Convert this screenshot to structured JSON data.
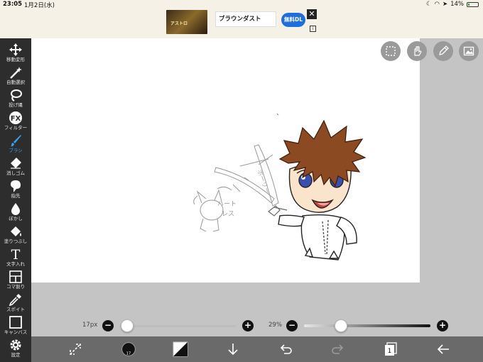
{
  "status_bar": {
    "time": "23:05",
    "date": "1月2日(水)",
    "battery_text": "14%",
    "battery_level": 0.14
  },
  "ad": {
    "thumb_text": "アストロ",
    "title": "ブラウンダスト",
    "cta": "無料DL",
    "close_glyph": "✕",
    "info_glyph": "i"
  },
  "toolbar": {
    "tools": [
      {
        "label": "移動変形",
        "icon": "move-icon"
      },
      {
        "label": "自動選択",
        "icon": "magic-wand-icon"
      },
      {
        "label": "投げ縄",
        "icon": "lasso-icon"
      },
      {
        "label": "フィルター",
        "icon": "fx-icon",
        "glyph": "FX"
      },
      {
        "label": "ブラシ",
        "icon": "brush-icon",
        "active": true
      },
      {
        "label": "消しゴム",
        "icon": "eraser-icon"
      },
      {
        "label": "指先",
        "icon": "finger-icon"
      },
      {
        "label": "ぼかし",
        "icon": "blur-drop-icon"
      },
      {
        "label": "塗りつぶし",
        "icon": "bucket-icon"
      },
      {
        "label": "文字入れ",
        "icon": "text-icon",
        "glyph": "T"
      },
      {
        "label": "コマ割り",
        "icon": "frame-icon"
      },
      {
        "label": "スポイト",
        "icon": "eyedropper-icon"
      },
      {
        "label": "キャンバス",
        "icon": "canvas-icon"
      },
      {
        "label": "設定",
        "icon": "gear-icon"
      }
    ]
  },
  "top_buttons": [
    "selection-icon",
    "hand-icon",
    "pen-icon",
    "image-icon"
  ],
  "brush_size": {
    "label": "17px",
    "value_fraction": 0.0,
    "minus": "−",
    "plus": "+"
  },
  "opacity": {
    "label": "29%",
    "value_fraction": 0.29,
    "minus": "−",
    "plus": "+"
  },
  "bottom_bar": {
    "brush_size_badge": "17",
    "layer_count": "1",
    "items": [
      "transform-arrows-icon",
      "brush-size-icon",
      "color-swatch-icon",
      "download-icon",
      "undo-icon",
      "redo-icon",
      "layers-icon",
      "back-arrow-icon"
    ]
  },
  "colors": {
    "toolbar_bg": "#2d2d2d",
    "bottom_bar_bg": "#6a6a6a",
    "active_tool": "#3aa0f0",
    "hair": "#8b4a22",
    "eyes": "#3a4fb0"
  }
}
